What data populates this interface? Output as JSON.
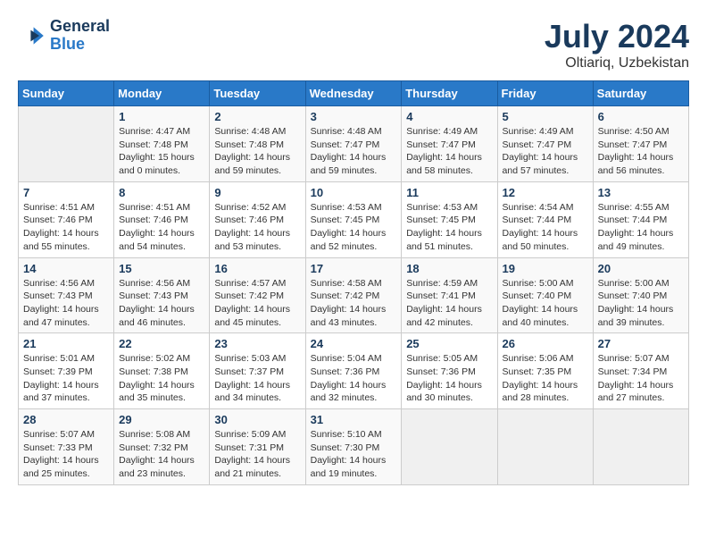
{
  "header": {
    "logo_general": "General",
    "logo_blue": "Blue",
    "month_year": "July 2024",
    "location": "Oltiariq, Uzbekistan"
  },
  "weekdays": [
    "Sunday",
    "Monday",
    "Tuesday",
    "Wednesday",
    "Thursday",
    "Friday",
    "Saturday"
  ],
  "weeks": [
    [
      {
        "day": "",
        "info": ""
      },
      {
        "day": "1",
        "info": "Sunrise: 4:47 AM\nSunset: 7:48 PM\nDaylight: 15 hours\nand 0 minutes."
      },
      {
        "day": "2",
        "info": "Sunrise: 4:48 AM\nSunset: 7:48 PM\nDaylight: 14 hours\nand 59 minutes."
      },
      {
        "day": "3",
        "info": "Sunrise: 4:48 AM\nSunset: 7:47 PM\nDaylight: 14 hours\nand 59 minutes."
      },
      {
        "day": "4",
        "info": "Sunrise: 4:49 AM\nSunset: 7:47 PM\nDaylight: 14 hours\nand 58 minutes."
      },
      {
        "day": "5",
        "info": "Sunrise: 4:49 AM\nSunset: 7:47 PM\nDaylight: 14 hours\nand 57 minutes."
      },
      {
        "day": "6",
        "info": "Sunrise: 4:50 AM\nSunset: 7:47 PM\nDaylight: 14 hours\nand 56 minutes."
      }
    ],
    [
      {
        "day": "7",
        "info": "Sunrise: 4:51 AM\nSunset: 7:46 PM\nDaylight: 14 hours\nand 55 minutes."
      },
      {
        "day": "8",
        "info": "Sunrise: 4:51 AM\nSunset: 7:46 PM\nDaylight: 14 hours\nand 54 minutes."
      },
      {
        "day": "9",
        "info": "Sunrise: 4:52 AM\nSunset: 7:46 PM\nDaylight: 14 hours\nand 53 minutes."
      },
      {
        "day": "10",
        "info": "Sunrise: 4:53 AM\nSunset: 7:45 PM\nDaylight: 14 hours\nand 52 minutes."
      },
      {
        "day": "11",
        "info": "Sunrise: 4:53 AM\nSunset: 7:45 PM\nDaylight: 14 hours\nand 51 minutes."
      },
      {
        "day": "12",
        "info": "Sunrise: 4:54 AM\nSunset: 7:44 PM\nDaylight: 14 hours\nand 50 minutes."
      },
      {
        "day": "13",
        "info": "Sunrise: 4:55 AM\nSunset: 7:44 PM\nDaylight: 14 hours\nand 49 minutes."
      }
    ],
    [
      {
        "day": "14",
        "info": "Sunrise: 4:56 AM\nSunset: 7:43 PM\nDaylight: 14 hours\nand 47 minutes."
      },
      {
        "day": "15",
        "info": "Sunrise: 4:56 AM\nSunset: 7:43 PM\nDaylight: 14 hours\nand 46 minutes."
      },
      {
        "day": "16",
        "info": "Sunrise: 4:57 AM\nSunset: 7:42 PM\nDaylight: 14 hours\nand 45 minutes."
      },
      {
        "day": "17",
        "info": "Sunrise: 4:58 AM\nSunset: 7:42 PM\nDaylight: 14 hours\nand 43 minutes."
      },
      {
        "day": "18",
        "info": "Sunrise: 4:59 AM\nSunset: 7:41 PM\nDaylight: 14 hours\nand 42 minutes."
      },
      {
        "day": "19",
        "info": "Sunrise: 5:00 AM\nSunset: 7:40 PM\nDaylight: 14 hours\nand 40 minutes."
      },
      {
        "day": "20",
        "info": "Sunrise: 5:00 AM\nSunset: 7:40 PM\nDaylight: 14 hours\nand 39 minutes."
      }
    ],
    [
      {
        "day": "21",
        "info": "Sunrise: 5:01 AM\nSunset: 7:39 PM\nDaylight: 14 hours\nand 37 minutes."
      },
      {
        "day": "22",
        "info": "Sunrise: 5:02 AM\nSunset: 7:38 PM\nDaylight: 14 hours\nand 35 minutes."
      },
      {
        "day": "23",
        "info": "Sunrise: 5:03 AM\nSunset: 7:37 PM\nDaylight: 14 hours\nand 34 minutes."
      },
      {
        "day": "24",
        "info": "Sunrise: 5:04 AM\nSunset: 7:36 PM\nDaylight: 14 hours\nand 32 minutes."
      },
      {
        "day": "25",
        "info": "Sunrise: 5:05 AM\nSunset: 7:36 PM\nDaylight: 14 hours\nand 30 minutes."
      },
      {
        "day": "26",
        "info": "Sunrise: 5:06 AM\nSunset: 7:35 PM\nDaylight: 14 hours\nand 28 minutes."
      },
      {
        "day": "27",
        "info": "Sunrise: 5:07 AM\nSunset: 7:34 PM\nDaylight: 14 hours\nand 27 minutes."
      }
    ],
    [
      {
        "day": "28",
        "info": "Sunrise: 5:07 AM\nSunset: 7:33 PM\nDaylight: 14 hours\nand 25 minutes."
      },
      {
        "day": "29",
        "info": "Sunrise: 5:08 AM\nSunset: 7:32 PM\nDaylight: 14 hours\nand 23 minutes."
      },
      {
        "day": "30",
        "info": "Sunrise: 5:09 AM\nSunset: 7:31 PM\nDaylight: 14 hours\nand 21 minutes."
      },
      {
        "day": "31",
        "info": "Sunrise: 5:10 AM\nSunset: 7:30 PM\nDaylight: 14 hours\nand 19 minutes."
      },
      {
        "day": "",
        "info": ""
      },
      {
        "day": "",
        "info": ""
      },
      {
        "day": "",
        "info": ""
      }
    ]
  ]
}
